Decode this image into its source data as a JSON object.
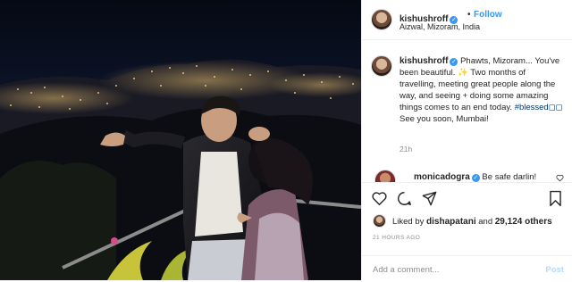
{
  "header": {
    "username": "kishushroff",
    "verified_glyph": "✓",
    "separator": "•",
    "follow_label": "Follow",
    "location": "Aizwal, Mizoram, India",
    "more_glyph": "•••"
  },
  "caption": {
    "username": "kishushroff",
    "text": "Phawts, Mizoram... You've been beautiful. ✨ Two months of travelling, meeting great people along the way, and seeing + doing some amazing things comes to an end today. ",
    "hashtag": "#blessed",
    "hashtag_suffix": "◻◻",
    "text_end": " See you soon, Mumbai!",
    "time": "21h"
  },
  "comment": {
    "username": "monicadogra",
    "text": " Be safe darlin!"
  },
  "likes": {
    "prefix": "Liked by ",
    "liker": "dishapatani",
    "middle": " and ",
    "count": "29,124 others"
  },
  "time_ago": "21 HOURS AGO",
  "add_comment": {
    "placeholder": "Add a comment...",
    "post_label": "Post"
  },
  "icons": [
    "heart-icon",
    "comment-icon",
    "share-icon",
    "bookmark-icon",
    "more-icon",
    "verified-badge-icon"
  ],
  "colors": {
    "accent": "#3897f0",
    "text": "#262626",
    "muted": "#8e8e8e",
    "hashtag": "#00376b",
    "post_disabled": "#b3dbff"
  }
}
